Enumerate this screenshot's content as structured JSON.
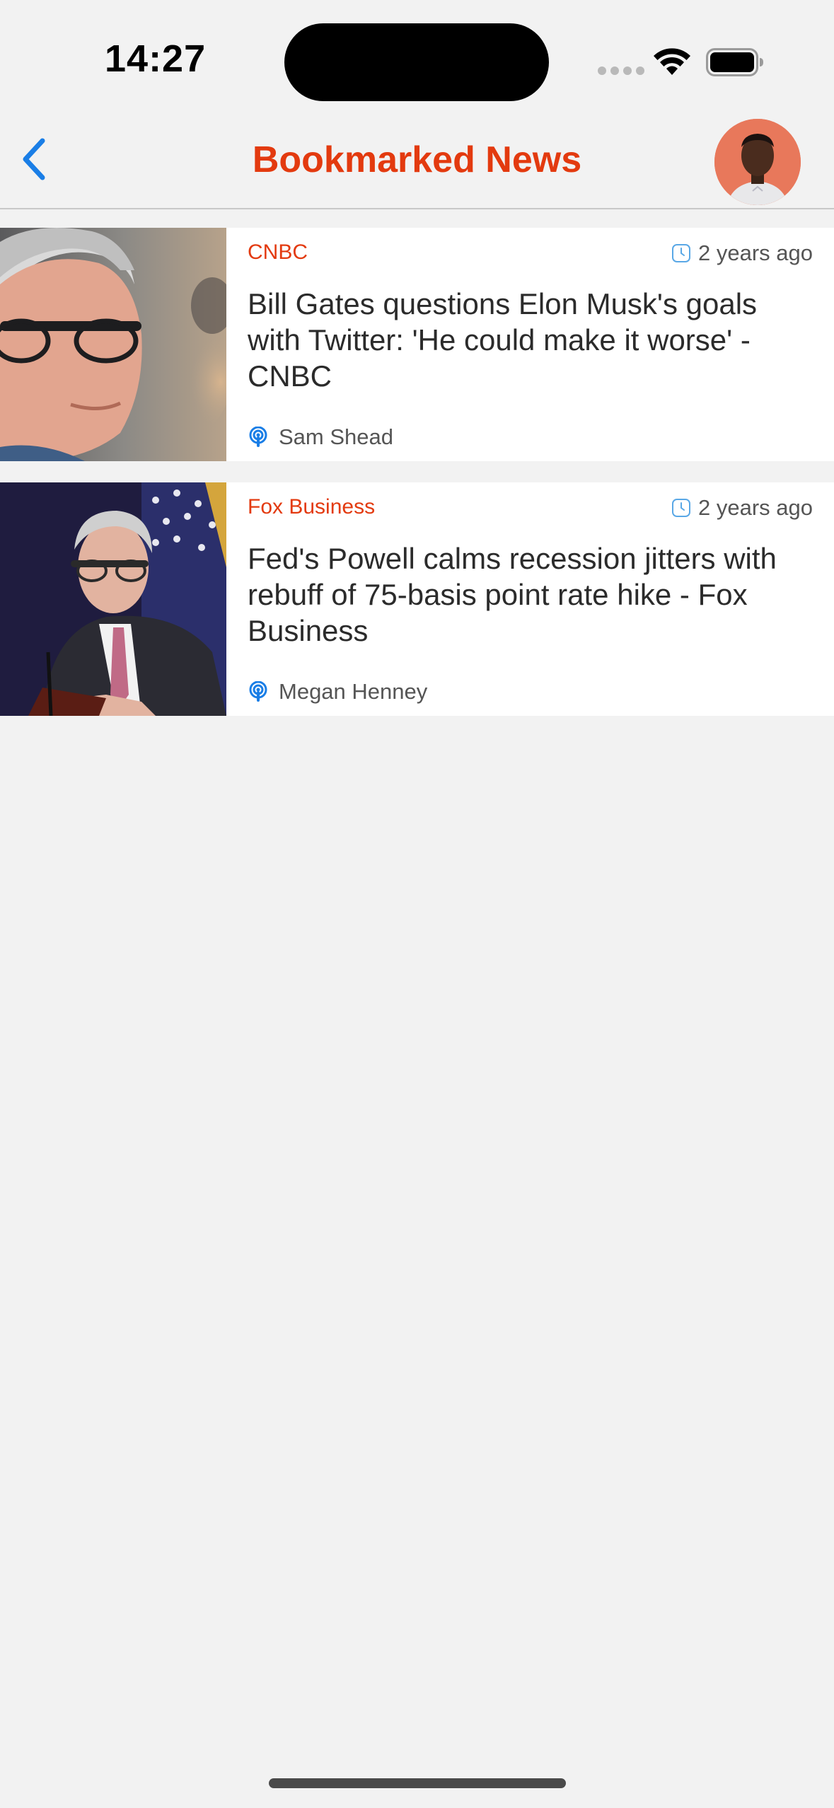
{
  "status_bar": {
    "time": "14:27"
  },
  "header": {
    "title": "Bookmarked News",
    "back_icon": "chevron-left-icon",
    "avatar_icon": "user-avatar"
  },
  "colors": {
    "accent": "#e33a0f",
    "link_blue": "#1a7ee6",
    "background": "#f2f2f2",
    "card": "#ffffff"
  },
  "articles": [
    {
      "source": "CNBC",
      "time_ago": "2 years ago",
      "headline": "Bill Gates questions Elon Musk's goals with Twitter: 'He could make it worse' - CNBC",
      "author": "Sam Shead",
      "image": "bill-gates-photo"
    },
    {
      "source": "Fox Business",
      "time_ago": "2 years ago",
      "headline": "Fed's Powell calms recession jitters with rebuff of 75-basis point rate hike - Fox Business",
      "author": "Megan Henney",
      "image": "jerome-powell-photo"
    }
  ]
}
